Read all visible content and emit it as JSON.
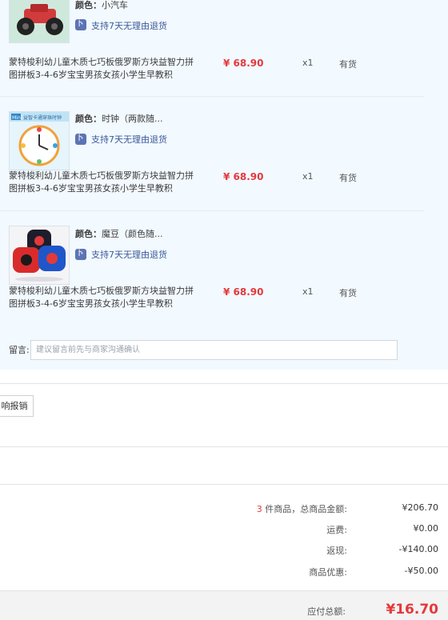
{
  "items": [
    {
      "attr_label": "颜色：",
      "attr_value": "小汽车",
      "return_policy": "支持7天无理由退货",
      "title": "蒙特梭利幼儿童木质七巧板俄罗斯方块益智力拼图拼板3-4-6岁宝宝男孩女孩小学生早教积",
      "price": "¥ 68.90",
      "quantity": "x1",
      "stock": "有货",
      "thumb_icon": "toy-car-image"
    },
    {
      "attr_label": "颜色：",
      "attr_value": "时钟（两款随...",
      "return_policy": "支持7天无理由退货",
      "title": "蒙特梭利幼儿童木质七巧板俄罗斯方块益智力拼图拼板3-4-6岁宝宝男孩女孩小学生早教积",
      "price": "¥ 68.90",
      "quantity": "x1",
      "stock": "有货",
      "thumb_icon": "toy-clock-image",
      "thumb_caption": "Mini 益智卡通穿珠时钟"
    },
    {
      "attr_label": "颜色：",
      "attr_value": "魔豆（颜色随...",
      "return_policy": "支持7天无理由退货",
      "title": "蒙特梭利幼儿童木质七巧板俄罗斯方块益智力拼图拼板3-4-6岁宝宝男孩女孩小学生早教积",
      "price": "¥ 68.90",
      "quantity": "x1",
      "stock": "有货",
      "thumb_icon": "magic-bean-toy-image"
    }
  ],
  "message": {
    "label": "留言:",
    "placeholder": "建议留言前先与商家沟通确认"
  },
  "invoice_button": "响报销",
  "summary": {
    "count": "3",
    "count_suffix": "件商品，总商品金额:",
    "goods_total": "¥206.70",
    "shipping_label": "运费:",
    "shipping_value": "¥0.00",
    "cashback_label": "返现:",
    "cashback_value": "-¥140.00",
    "discount_label": "商品优惠:",
    "discount_value": "-¥50.00",
    "payable_label": "应付总额:",
    "payable_value": "¥16.70"
  },
  "colors": {
    "price": "#e4393c",
    "panel_bg": "#f2f9ff",
    "link": "#3b5998"
  }
}
